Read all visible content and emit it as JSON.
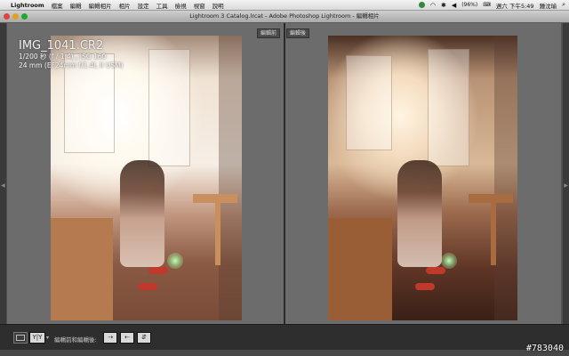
{
  "menubar": {
    "app": "Lightroom",
    "items": [
      "檔案",
      "編輯",
      "編輯相片",
      "相片",
      "設定",
      "工具",
      "檢視",
      "視窗",
      "說明"
    ],
    "battery": "(96%)",
    "clock": "週六 下午5:49",
    "user": "鍾沈瑜"
  },
  "window": {
    "title": "Lightroom 3 Catalog.lrcat - Adobe Photoshop Lightroom - 編輯相片"
  },
  "panes": {
    "before_label": "編輯前",
    "after_label": "編輯後"
  },
  "photo_info": {
    "filename": "IMG_1041.CR2",
    "exposure": "1/200 秒 (f / 1.4) , ISO 160",
    "lens": "24 mm (EF24mm f/1.4L II USM)"
  },
  "toolbar": {
    "view_icon": "single-view-icon",
    "compare_label": "Y|Y",
    "before_after_label": "編輯前和編輯後:",
    "btn1": "⇢",
    "btn2": "⇠",
    "btn3": "⇵"
  },
  "watermark": "#783040",
  "colors": {
    "menubar": "#e6e6e6",
    "workspace": "#6c6c6c",
    "toolbar": "#2e2e2e",
    "accent_shoes": "#c0392b"
  }
}
